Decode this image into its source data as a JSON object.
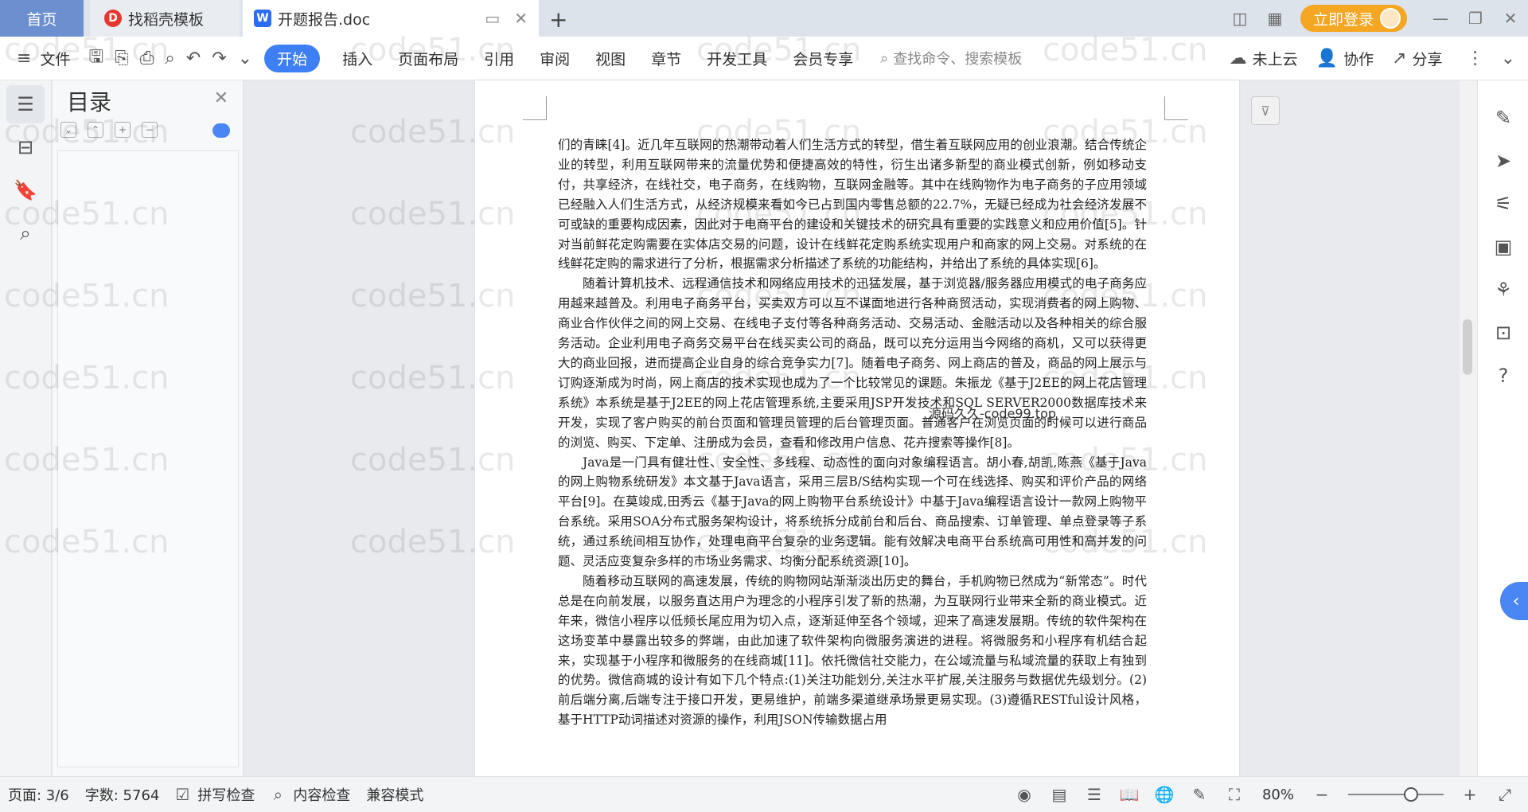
{
  "tabs": {
    "home": "首页",
    "template": "找稻壳模板",
    "document": "开题报告.doc"
  },
  "titlebar": {
    "login": "立即登录"
  },
  "ribbon": {
    "file": "文件",
    "start": "开始",
    "insert": "插入",
    "layout": "页面布局",
    "reference": "引用",
    "review": "审阅",
    "view": "视图",
    "chapter": "章节",
    "devtools": "开发工具",
    "member": "会员专享",
    "search_placeholder": "查找命令、搜索模板",
    "cloud": "未上云",
    "collab": "协作",
    "share": "分享"
  },
  "toc": {
    "title": "目录"
  },
  "document": {
    "overlay": "源码久久-code99.top",
    "paragraphs": [
      "们的青睐[4]。近几年互联网的热潮带动着人们生活方式的转型，借生着互联网应用的创业浪潮。结合传统企业的转型，利用互联网带来的流量优势和便捷高效的特性，衍生出诸多新型的商业模式创新，例如移动支付，共享经济，在线社交，电子商务，在线购物，互联网金融等。其中在线购物作为电子商务的子应用领域已经融入人们生活方式，从经济规模来看如今已占到国内零售总额的22.7%，无疑已经成为社会经济发展不可或缺的重要构成因素，因此对于电商平台的建设和关键技术的研究具有重要的实践意义和应用价值[5]。针对当前鲜花定购需要在实体店交易的问题，设计在线鲜花定购系统实现用户和商家的网上交易。对系统的在线鲜花定购的需求进行了分析，根据需求分析描述了系统的功能结构，并给出了系统的具体实现[6]。",
      "随着计算机技术、远程通信技术和网络应用技术的迅猛发展，基于浏览器/服务器应用模式的电子商务应用越来越普及。利用电子商务平台，买卖双方可以互不谋面地进行各种商贸活动，实现消费者的网上购物、商业合作伙伴之间的网上交易、在线电子支付等各种商务活动、交易活动、金融活动以及各种相关的综合服务活动。企业利用电子商务交易平台在线买卖公司的商品，既可以充分运用当今网络的商机，又可以获得更大的商业回报，进而提高企业自身的综合竞争实力[7]。随着电子商务、网上商店的普及，商品的网上展示与订购逐渐成为时尚，网上商店的技术实现也成为了一个比较常见的课题。朱振龙《基于J2EE的网上花店管理系统》本系统是基于J2EE的网上花店管理系统,主要采用JSP开发技术和SQL SERVER2000数据库技术来开发，实现了客户购买的前台页面和管理员管理的后台管理页面。普通客户在浏览页面的时候可以进行商品的浏览、购买、下定单、注册成为会员，查看和修改用户信息、花卉搜索等操作[8]。",
      "Java是一门具有健壮性、安全性、多线程、动态性的面向对象编程语言。胡小春,胡凯,陈燕《基于Java的网上购物系统研发》本文基于Java语言，采用三层B/S结构实现一个可在线选择、购买和评价产品的网络平台[9]。在莫竣成,田秀云《基于Java的网上购物平台系统设计》中基于Java编程语言设计一款网上购物平台系统。采用SOA分布式服务架构设计，将系统拆分成前台和后台、商品搜索、订单管理、单点登录等子系统，通过系统间相互协作，处理电商平台复杂的业务逻辑。能有效解决电商平台系统高可用性和高并发的问题、灵活应变复杂多样的市场业务需求、均衡分配系统资源[10]。",
      "随着移动互联网的高速发展，传统的购物网站渐渐淡出历史的舞台，手机购物已然成为“新常态”。时代总是在向前发展，以服务直达用户为理念的小程序引发了新的热潮，为互联网行业带来全新的商业模式。近年来，微信小程序以低频长尾应用为切入点，逐渐延伸至各个领域，迎来了高速发展期。传统的软件架构在这场变革中暴露出较多的弊端，由此加速了软件架构向微服务演进的进程。将微服务和小程序有机结合起来，实现基于小程序和微服务的在线商城[11]。依托微信社交能力，在公域流量与私域流量的获取上有独到的优势。微信商城的设计有如下几个特点:(1)关注功能划分,关注水平扩展,关注服务与数据优先级划分。(2)前后端分离,后端专注于接口开发，更易维护，前端多渠道继承场景更易实现。(3)遵循RESTful设计风格，基于HTTP动词描述对资源的操作，利用JSON传输数据占用"
    ]
  },
  "statusbar": {
    "page": "页面: 3/6",
    "words": "字数: 5764",
    "spell": "拼写检查",
    "content_check": "内容检查",
    "compat": "兼容模式",
    "zoom": "80%"
  },
  "watermark": "code51.cn"
}
